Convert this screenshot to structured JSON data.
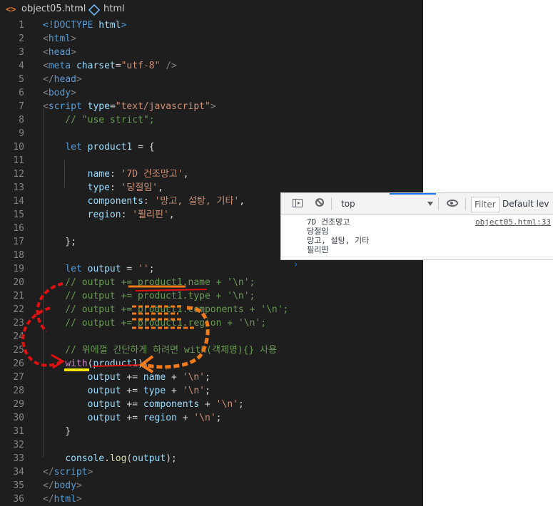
{
  "breadcrumb": {
    "file": "object05.html",
    "separator": "›",
    "symbol": "html"
  },
  "code_lines": [
    [
      [
        "<!DOCTYPE ",
        "t-tag"
      ],
      [
        "html",
        "t-attr"
      ],
      [
        ">",
        "t-tag"
      ]
    ],
    [
      [
        "<",
        "t-punc"
      ],
      [
        "html",
        "t-tag"
      ],
      [
        ">",
        "t-punc"
      ]
    ],
    [
      [
        "<",
        "t-punc"
      ],
      [
        "head",
        "t-tag"
      ],
      [
        ">",
        "t-punc"
      ]
    ],
    [
      [
        "<",
        "t-punc"
      ],
      [
        "meta ",
        "t-tag"
      ],
      [
        "charset",
        "t-attr"
      ],
      [
        "=",
        "t-plain"
      ],
      [
        "\"utf-8\"",
        "t-str"
      ],
      [
        " />",
        "t-punc"
      ]
    ],
    [
      [
        "</",
        "t-punc"
      ],
      [
        "head",
        "t-tag"
      ],
      [
        ">",
        "t-punc"
      ]
    ],
    [
      [
        "<",
        "t-punc"
      ],
      [
        "body",
        "t-tag"
      ],
      [
        ">",
        "t-punc"
      ]
    ],
    [
      [
        "<",
        "t-punc"
      ],
      [
        "script ",
        "t-tag"
      ],
      [
        "type",
        "t-attr"
      ],
      [
        "=",
        "t-plain"
      ],
      [
        "\"text/javascript\"",
        "t-str"
      ],
      [
        ">",
        "t-punc"
      ]
    ],
    [
      [
        "    // \"use strict\";",
        "t-com"
      ]
    ],
    [
      [
        "",
        ""
      ]
    ],
    [
      [
        "    ",
        "t-plain"
      ],
      [
        "let ",
        "t-kw"
      ],
      [
        "product1",
        "t-var"
      ],
      [
        " = {",
        "t-plain"
      ]
    ],
    [
      [
        "",
        ""
      ]
    ],
    [
      [
        "        ",
        "t-plain"
      ],
      [
        "name",
        "t-var"
      ],
      [
        ": ",
        "t-plain"
      ],
      [
        "'7D 건조망고'",
        "t-str"
      ],
      [
        ",",
        "t-plain"
      ]
    ],
    [
      [
        "        ",
        "t-plain"
      ],
      [
        "type",
        "t-var"
      ],
      [
        ": ",
        "t-plain"
      ],
      [
        "'당절임'",
        "t-str"
      ],
      [
        ",",
        "t-plain"
      ]
    ],
    [
      [
        "        ",
        "t-plain"
      ],
      [
        "components",
        "t-var"
      ],
      [
        ": ",
        "t-plain"
      ],
      [
        "'망고, 설탕, 기타'",
        "t-str"
      ],
      [
        ",",
        "t-plain"
      ]
    ],
    [
      [
        "        ",
        "t-plain"
      ],
      [
        "region",
        "t-var"
      ],
      [
        ": ",
        "t-plain"
      ],
      [
        "'필리핀'",
        "t-str"
      ],
      [
        ",",
        "t-plain"
      ]
    ],
    [
      [
        "",
        ""
      ]
    ],
    [
      [
        "    };",
        "t-plain"
      ]
    ],
    [
      [
        "",
        ""
      ]
    ],
    [
      [
        "    ",
        "t-plain"
      ],
      [
        "let ",
        "t-kw"
      ],
      [
        "output",
        "t-var"
      ],
      [
        " = ",
        "t-plain"
      ],
      [
        "''",
        "t-str"
      ],
      [
        ";",
        "t-plain"
      ]
    ],
    [
      [
        "    // output += product1.name + '\\n';",
        "t-com"
      ]
    ],
    [
      [
        "    // output += product1.type + '\\n';",
        "t-com"
      ]
    ],
    [
      [
        "    // output += product1.components + '\\n';",
        "t-com"
      ]
    ],
    [
      [
        "    // output += product1.region + '\\n';",
        "t-com"
      ]
    ],
    [
      [
        "",
        ""
      ]
    ],
    [
      [
        "    // 위에껄 간단하게 하려면 with(객체명){} 사용",
        "t-com"
      ]
    ],
    [
      [
        "    ",
        "t-plain"
      ],
      [
        "with",
        "t-with"
      ],
      [
        "(",
        "t-plain"
      ],
      [
        "product1",
        "t-var"
      ],
      [
        "){",
        "t-plain"
      ]
    ],
    [
      [
        "        ",
        "t-plain"
      ],
      [
        "output",
        "t-var"
      ],
      [
        " += ",
        "t-plain"
      ],
      [
        "name",
        "t-var"
      ],
      [
        " + ",
        "t-plain"
      ],
      [
        "'\\n'",
        "t-str"
      ],
      [
        ";",
        "t-plain"
      ]
    ],
    [
      [
        "        ",
        "t-plain"
      ],
      [
        "output",
        "t-var"
      ],
      [
        " += ",
        "t-plain"
      ],
      [
        "type",
        "t-var"
      ],
      [
        " + ",
        "t-plain"
      ],
      [
        "'\\n'",
        "t-str"
      ],
      [
        ";",
        "t-plain"
      ]
    ],
    [
      [
        "        ",
        "t-plain"
      ],
      [
        "output",
        "t-var"
      ],
      [
        " += ",
        "t-plain"
      ],
      [
        "components",
        "t-var"
      ],
      [
        " + ",
        "t-plain"
      ],
      [
        "'\\n'",
        "t-str"
      ],
      [
        ";",
        "t-plain"
      ]
    ],
    [
      [
        "        ",
        "t-plain"
      ],
      [
        "output",
        "t-var"
      ],
      [
        " += ",
        "t-plain"
      ],
      [
        "region",
        "t-var"
      ],
      [
        " + ",
        "t-plain"
      ],
      [
        "'\\n'",
        "t-str"
      ],
      [
        ";",
        "t-plain"
      ]
    ],
    [
      [
        "    }",
        "t-plain"
      ]
    ],
    [
      [
        "",
        ""
      ]
    ],
    [
      [
        "    ",
        "t-plain"
      ],
      [
        "console",
        "t-var"
      ],
      [
        ".",
        "t-plain"
      ],
      [
        "log",
        "t-fn"
      ],
      [
        "(",
        "t-plain"
      ],
      [
        "output",
        "t-var"
      ],
      [
        ");",
        "t-plain"
      ]
    ],
    [
      [
        "</",
        "t-punc"
      ],
      [
        "script",
        "t-tag"
      ],
      [
        ">",
        "t-punc"
      ]
    ],
    [
      [
        "</",
        "t-punc"
      ],
      [
        "body",
        "t-tag"
      ],
      [
        ">",
        "t-punc"
      ]
    ],
    [
      [
        "</",
        "t-punc"
      ],
      [
        "html",
        "t-tag"
      ],
      [
        ">",
        "t-punc"
      ]
    ]
  ],
  "console": {
    "context": "top",
    "filter_placeholder": "Filter",
    "levels": "Default lev",
    "output_lines": [
      "7D 건조망고",
      "당절임",
      "망고, 설탕, 기타",
      "필리핀"
    ],
    "source": "object05.html:33",
    "prompt": "›"
  },
  "colors": {
    "editor_bg": "#1e1e1e",
    "annotation_red": "#e01010",
    "annotation_orange": "#f07a1a",
    "annotation_yellow": "#f2e600"
  }
}
